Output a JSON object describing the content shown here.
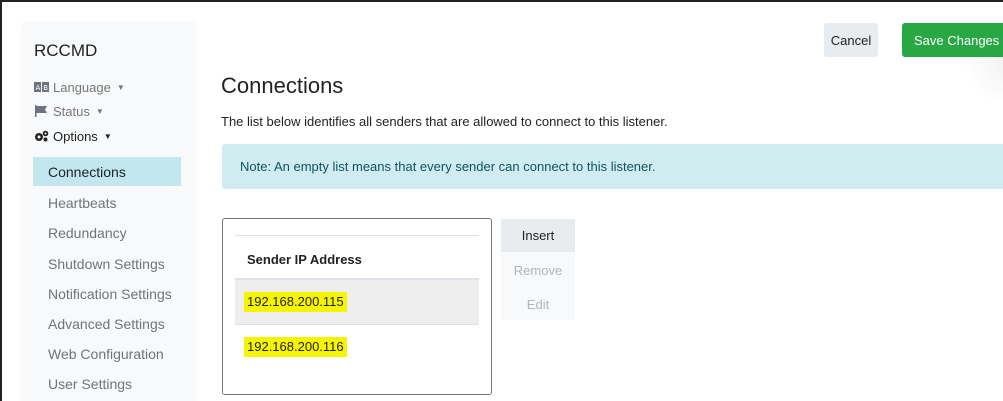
{
  "sidebar": {
    "brand": "RCCMD",
    "nav_headers": [
      {
        "label": "Language",
        "icon": "language-icon"
      },
      {
        "label": "Status",
        "icon": "flag-icon"
      },
      {
        "label": "Options",
        "icon": "gears-icon"
      }
    ],
    "sub_items": [
      {
        "label": "Connections",
        "active": true
      },
      {
        "label": "Heartbeats"
      },
      {
        "label": "Redundancy"
      },
      {
        "label": "Shutdown Settings"
      },
      {
        "label": "Notification Settings"
      },
      {
        "label": "Advanced Settings"
      },
      {
        "label": "Web Configuration"
      },
      {
        "label": "User Settings"
      }
    ]
  },
  "toolbar": {
    "cancel_label": "Cancel",
    "save_label": "Save Changes"
  },
  "main": {
    "title": "Connections",
    "description": "The list below identifies all senders that are allowed to connect to this listener.",
    "note": "Note: An empty list means that every sender can connect to this listener.",
    "table": {
      "header": "Sender IP Address",
      "rows": [
        "192.168.200.115",
        "192.168.200.116"
      ]
    },
    "actions": {
      "insert_label": "Insert",
      "remove_label": "Remove",
      "edit_label": "Edit"
    }
  },
  "colors": {
    "save_button": "#28a745",
    "alert_bg": "#d1ecf1",
    "active_nav": "#c2e7ef",
    "highlight": "#f5f500"
  }
}
